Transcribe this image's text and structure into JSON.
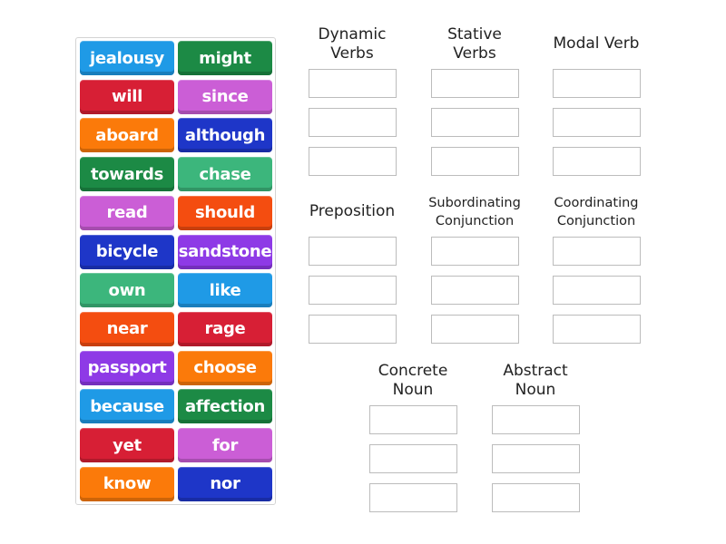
{
  "tiles": [
    {
      "label": "jealousy",
      "color": "#1f9ae6"
    },
    {
      "label": "might",
      "color": "#1c8a45"
    },
    {
      "label": "will",
      "color": "#d71f35"
    },
    {
      "label": "since",
      "color": "#cb5ed6"
    },
    {
      "label": "aboard",
      "color": "#fb7a0a"
    },
    {
      "label": "although",
      "color": "#1e36c8"
    },
    {
      "label": "towards",
      "color": "#1c8a45"
    },
    {
      "label": "chase",
      "color": "#3cb67c"
    },
    {
      "label": "read",
      "color": "#cb5ed6"
    },
    {
      "label": "should",
      "color": "#f44d10"
    },
    {
      "label": "bicycle",
      "color": "#1e36c8"
    },
    {
      "label": "sandstone",
      "color": "#8e3ae6"
    },
    {
      "label": "own",
      "color": "#3cb67c"
    },
    {
      "label": "like",
      "color": "#1f9ae6"
    },
    {
      "label": "near",
      "color": "#f44d10"
    },
    {
      "label": "rage",
      "color": "#d71f35"
    },
    {
      "label": "passport",
      "color": "#8e3ae6"
    },
    {
      "label": "choose",
      "color": "#fb7a0a"
    },
    {
      "label": "because",
      "color": "#1f9ae6"
    },
    {
      "label": "affection",
      "color": "#1c8a45"
    },
    {
      "label": "yet",
      "color": "#d71f35"
    },
    {
      "label": "for",
      "color": "#cb5ed6"
    },
    {
      "label": "know",
      "color": "#fb7a0a"
    },
    {
      "label": "nor",
      "color": "#1e36c8"
    }
  ],
  "categories": [
    {
      "line1": "Dynamic",
      "line2": "Verbs",
      "slots": 3
    },
    {
      "line1": "Stative",
      "line2": "Verbs",
      "slots": 3
    },
    {
      "line1": "Modal Verb",
      "line2": "",
      "slots": 3
    },
    {
      "line1": "Preposition",
      "line2": "",
      "slots": 3
    },
    {
      "line1": "Subordinating",
      "line2": "Conjunction",
      "slots": 3
    },
    {
      "line1": "Coordinating",
      "line2": "Conjunction",
      "slots": 3
    },
    {
      "line1": "Concrete",
      "line2": "Noun",
      "slots": 3
    },
    {
      "line1": "Abstract",
      "line2": "Noun",
      "slots": 3
    }
  ]
}
